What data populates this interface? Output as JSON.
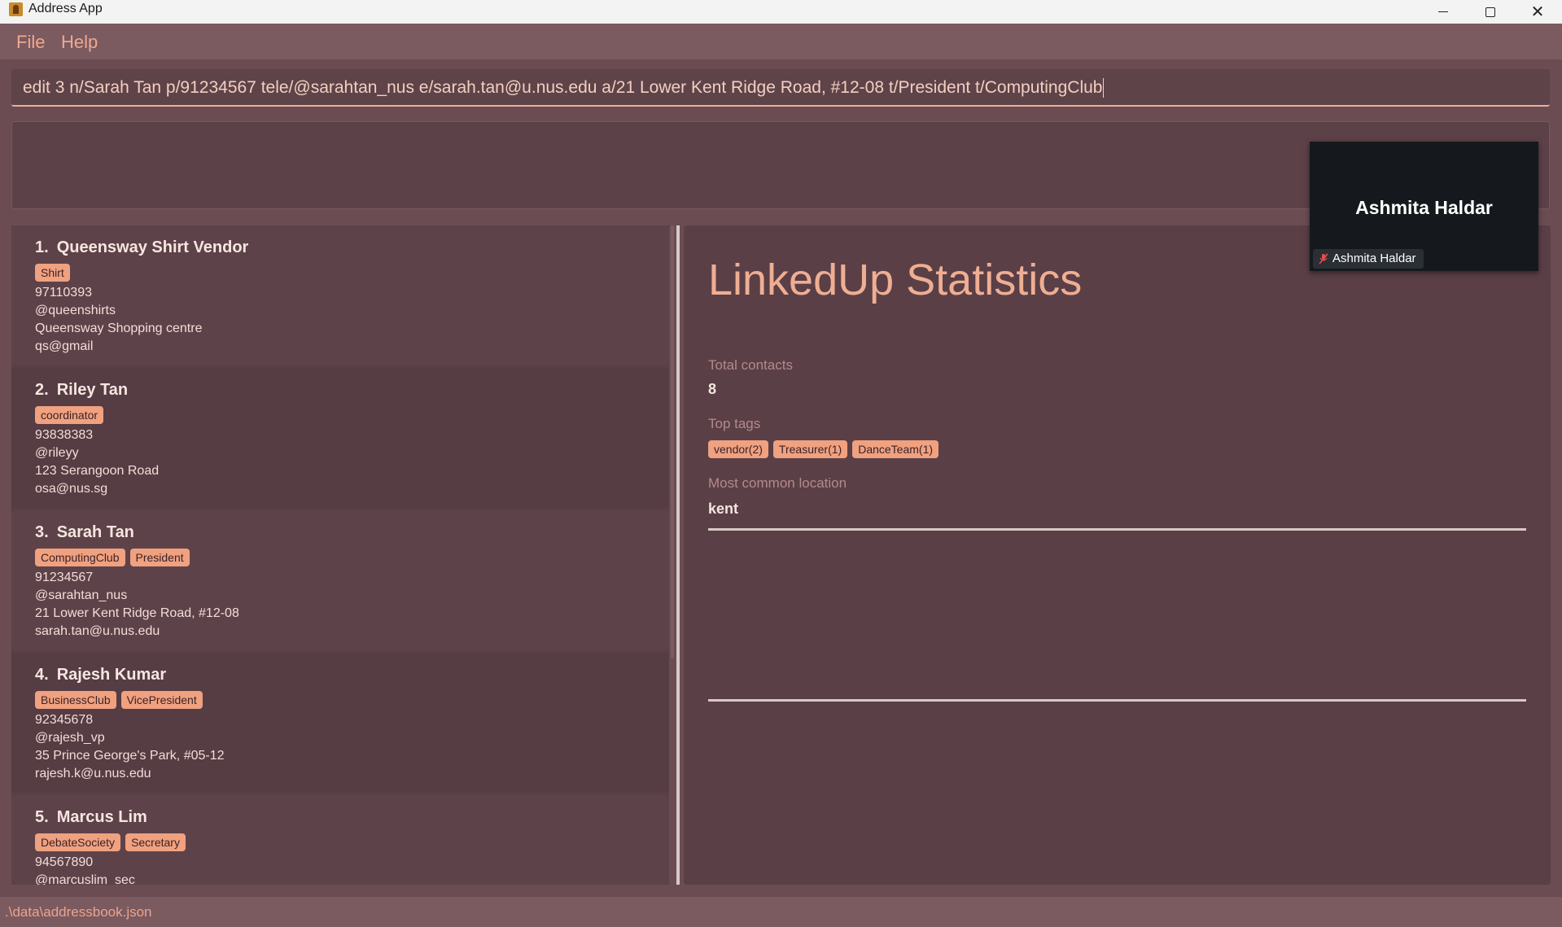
{
  "window": {
    "title": "Address App",
    "minimize_icon": "minimize-icon",
    "maximize_icon": "maximize-icon",
    "close_icon": "close-icon"
  },
  "menu": {
    "items": [
      "File",
      "Help"
    ]
  },
  "command": {
    "value": "edit 3 n/Sarah Tan p/91234567 tele/@sarahtan_nus e/sarah.tan@u.nus.edu a/21 Lower Kent Ridge Road, #12-08 t/President t/ComputingClub"
  },
  "result": {
    "text": ""
  },
  "contacts": [
    {
      "index": "1.",
      "name": "Queensway Shirt Vendor",
      "tags": [
        "Shirt"
      ],
      "phone": "97110393",
      "telegram": "@queenshirts",
      "address": "Queensway Shopping centre",
      "email": "qs@gmail"
    },
    {
      "index": "2.",
      "name": "Riley Tan",
      "tags": [
        "coordinator"
      ],
      "phone": "93838383",
      "telegram": "@rileyy",
      "address": "123 Serangoon Road",
      "email": "osa@nus.sg"
    },
    {
      "index": "3.",
      "name": "Sarah Tan",
      "tags": [
        "ComputingClub",
        "President"
      ],
      "phone": "91234567",
      "telegram": "@sarahtan_nus",
      "address": "21 Lower Kent Ridge Road, #12-08",
      "email": "sarah.tan@u.nus.edu"
    },
    {
      "index": "4.",
      "name": "Rajesh Kumar",
      "tags": [
        "BusinessClub",
        "VicePresident"
      ],
      "phone": "92345678",
      "telegram": "@rajesh_vp",
      "address": "35 Prince George's Park, #05-12",
      "email": "rajesh.k@u.nus.edu"
    },
    {
      "index": "5.",
      "name": "Marcus Lim",
      "tags": [
        "DebateSociety",
        "Secretary"
      ],
      "phone": "94567890",
      "telegram": "@marcuslim_sec",
      "address": "",
      "email": ""
    }
  ],
  "stats": {
    "title": "LinkedUp Statistics",
    "total_label": "Total contacts",
    "total_value": "8",
    "top_tags_label": "Top tags",
    "top_tags": [
      "vendor(2)",
      "Treasurer(1)",
      "DanceTeam(1)"
    ],
    "location_label": "Most common location",
    "location_value": "kent"
  },
  "video_overlay": {
    "participant_name": "Ashmita Haldar",
    "name_tag": "Ashmita Haldar",
    "mic_icon": "mic-muted-icon"
  },
  "status": {
    "path": ".\\data\\addressbook.json"
  },
  "colors": {
    "accent": "#f0a17f",
    "background": "#5a3f46",
    "menu": "#7b5a60"
  }
}
